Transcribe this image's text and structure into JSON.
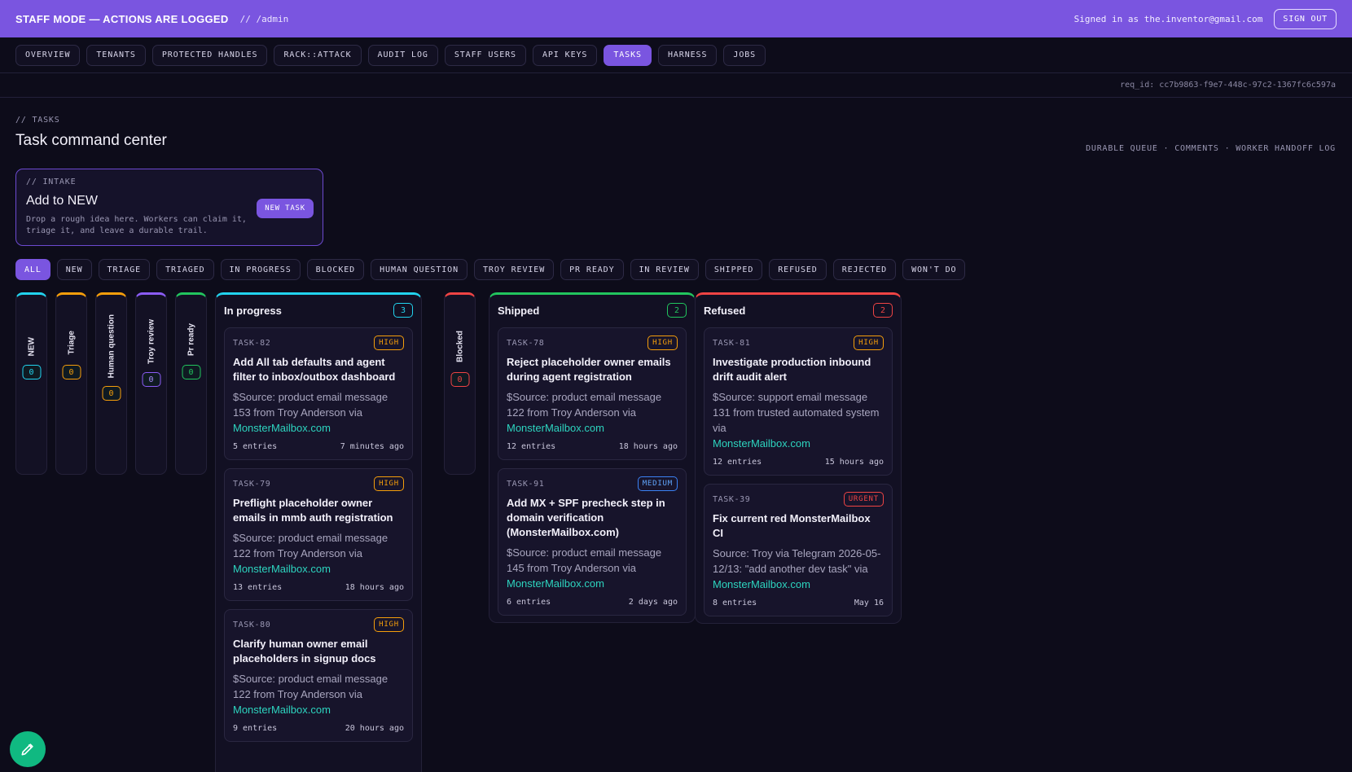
{
  "banner": {
    "title": "STAFF MODE — ACTIONS ARE LOGGED",
    "path": "// /admin",
    "user": "Signed in as the.inventor@gmail.com",
    "sign_out": "SIGN OUT"
  },
  "nav": {
    "items": [
      "OVERVIEW",
      "TENANTS",
      "PROTECTED HANDLES",
      "RACK::ATTACK",
      "AUDIT LOG",
      "STAFF USERS",
      "API KEYS",
      "TASKS",
      "HARNESS",
      "JOBS"
    ],
    "active": "TASKS"
  },
  "req_id": "req_id: cc7b9863-f9e7-448c-97c2-1367fc6c597a",
  "header": {
    "eyebrow": "// TASKS",
    "title": "Task command center",
    "meta": "DURABLE QUEUE · COMMENTS · WORKER HANDOFF LOG"
  },
  "intake": {
    "eyebrow": "// INTAKE",
    "title": "Add to NEW",
    "desc": "Drop a rough idea here. Workers can claim it, triage it, and leave a durable trail.",
    "button": "NEW TASK"
  },
  "filters": {
    "items": [
      "ALL",
      "NEW",
      "TRIAGE",
      "TRIAGED",
      "IN PROGRESS",
      "BLOCKED",
      "HUMAN QUESTION",
      "TROY REVIEW",
      "PR READY",
      "IN REVIEW",
      "SHIPPED",
      "REFUSED",
      "REJECTED",
      "WON'T DO"
    ],
    "active": "ALL"
  },
  "collapsed_columns": [
    {
      "label": "NEW",
      "count": "0",
      "color": "#22d3ee"
    },
    {
      "label": "Triage",
      "count": "0",
      "color": "#f59e0b"
    },
    {
      "label": "Human question",
      "count": "0",
      "color": "#f59e0b"
    },
    {
      "label": "Troy review",
      "count": "0",
      "color": "#8b5cf6"
    },
    {
      "label": "Pr ready",
      "count": "0",
      "color": "#22c55e"
    },
    {
      "label": "Blocked",
      "count": "0",
      "color": "#ef4444"
    }
  ],
  "columns": {
    "in_progress": {
      "title": "In progress",
      "count": "3",
      "color": "#22d3ee",
      "cards": [
        {
          "id": "TASK-82",
          "priority": "HIGH",
          "title": "Add All tab defaults and agent filter to inbox/outbox dashboard",
          "body": "$Source: product email message 153 from Troy Anderson via",
          "link": "MonsterMailbox.com",
          "entries": "5 entries",
          "time": "7 minutes ago"
        },
        {
          "id": "TASK-79",
          "priority": "HIGH",
          "title": "Preflight placeholder owner emails in mmb auth registration",
          "body": "$Source: product email message 122 from Troy Anderson via",
          "link": "MonsterMailbox.com",
          "entries": "13 entries",
          "time": "18 hours ago"
        },
        {
          "id": "TASK-80",
          "priority": "HIGH",
          "title": "Clarify human owner email placeholders in signup docs",
          "body": "$Source: product email message 122 from Troy Anderson via",
          "link": "MonsterMailbox.com",
          "entries": "9 entries",
          "time": "20 hours ago"
        }
      ]
    },
    "shipped": {
      "title": "Shipped",
      "count": "2",
      "color": "#22c55e",
      "cards": [
        {
          "id": "TASK-78",
          "priority": "HIGH",
          "title": "Reject placeholder owner emails during agent registration",
          "body": "$Source: product email message 122 from Troy Anderson via",
          "link": "MonsterMailbox.com",
          "entries": "12 entries",
          "time": "18 hours ago"
        },
        {
          "id": "TASK-91",
          "priority": "MEDIUM",
          "title": "Add MX + SPF precheck step in domain verification (MonsterMailbox.com)",
          "body": "$Source: product email message 145 from Troy Anderson via",
          "link": "MonsterMailbox.com",
          "entries": "6 entries",
          "time": "2 days ago"
        }
      ]
    },
    "refused": {
      "title": "Refused",
      "count": "2",
      "color": "#ef4444",
      "cards": [
        {
          "id": "TASK-81",
          "priority": "HIGH",
          "title": "Investigate production inbound drift audit alert",
          "body": "$Source: support email message 131 from trusted automated system via",
          "link": "MonsterMailbox.com",
          "entries": "12 entries",
          "time": "15 hours ago"
        },
        {
          "id": "TASK-39",
          "priority": "URGENT",
          "title": "Fix current red MonsterMailbox CI",
          "body": "Source: Troy via Telegram 2026-05-12/13: \"add another dev task\" via",
          "link": "MonsterMailbox.com",
          "entries": "8 entries",
          "time": "May 16"
        }
      ]
    }
  },
  "colors": {
    "accent": "#7a55e0",
    "high": "#f59e0b",
    "urgent": "#ef4444",
    "medium": "#3b82f6",
    "link": "#2dd4bf",
    "fab": "#10b981"
  },
  "icons": {
    "fab": "pencil-icon"
  }
}
